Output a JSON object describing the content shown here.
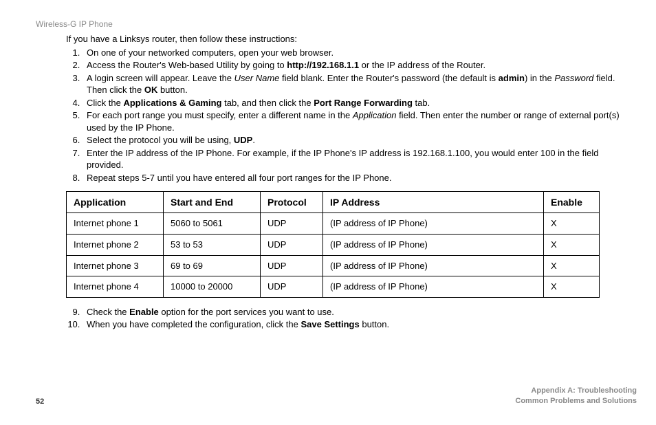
{
  "header": {
    "title": "Wireless-G IP Phone"
  },
  "intro": "If you have a Linksys router, then follow these instructions:",
  "steps": {
    "s1": "On one of your networked computers, open your web browser.",
    "s2_a": "Access the Router's Web-based Utility by going to ",
    "s2_b": "http://192.168.1.1",
    "s2_c": " or the IP address of the Router.",
    "s3_a": "A login screen will appear. Leave the ",
    "s3_b": "User Name",
    "s3_c": " field blank. Enter the Router's password (the default is ",
    "s3_d": "admin",
    "s3_e": ") in the ",
    "s3_f": "Password",
    "s3_g": " field. Then click the ",
    "s3_h": "OK",
    "s3_i": " button.",
    "s4_a": "Click the ",
    "s4_b": "Applications & Gaming",
    "s4_c": " tab, and then click the ",
    "s4_d": "Port Range Forwarding",
    "s4_e": " tab.",
    "s5_a": "For each port range you must specify, enter a different name in the ",
    "s5_b": "Application",
    "s5_c": " field. Then enter the number or range of external port(s) used by the IP Phone.",
    "s6_a": "Select the protocol you will be using, ",
    "s6_b": "UDP",
    "s6_c": ".",
    "s7": "Enter the IP address of the IP Phone. For example, if the IP Phone's IP address is 192.168.1.100, you would enter 100 in the field provided.",
    "s8": "Repeat steps 5-7 until you have entered all four port ranges for the IP Phone.",
    "s9_a": "Check the ",
    "s9_b": "Enable",
    "s9_c": " option for the port services you want to use.",
    "s10_a": "When you have completed the configuration, click the ",
    "s10_b": "Save Settings",
    "s10_c": " button."
  },
  "table": {
    "headers": {
      "application": "Application",
      "start_end": "Start and End",
      "protocol": "Protocol",
      "ip_address": "IP Address",
      "enable": "Enable"
    },
    "rows": [
      {
        "app": "Internet phone 1",
        "range": "5060 to 5061",
        "proto": "UDP",
        "ip": "(IP address of IP Phone)",
        "enable": "X"
      },
      {
        "app": "Internet phone 2",
        "range": "53 to 53",
        "proto": "UDP",
        "ip": "(IP address of IP Phone)",
        "enable": "X"
      },
      {
        "app": "Internet phone 3",
        "range": "69 to 69",
        "proto": "UDP",
        "ip": "(IP address of IP Phone)",
        "enable": "X"
      },
      {
        "app": "Internet phone 4",
        "range": "10000 to 20000",
        "proto": "UDP",
        "ip": "(IP address of IP Phone)",
        "enable": "X"
      }
    ]
  },
  "footer": {
    "page": "52",
    "appendix_l1": "Appendix A: Troubleshooting",
    "appendix_l2": "Common Problems and Solutions"
  }
}
